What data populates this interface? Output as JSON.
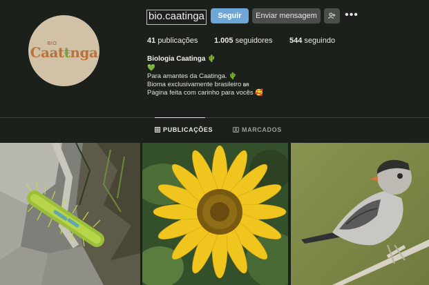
{
  "profile": {
    "username": "bio.caatinga",
    "avatar": {
      "logo_small": "BIO",
      "logo_main_left": "Caat",
      "logo_main_mid": "ŧ",
      "logo_main_right": "nga"
    }
  },
  "actions": {
    "follow_label": "Seguir",
    "message_label": "Enviar mensagem",
    "suggest_icon": "person-add-icon",
    "more_icon": "•••"
  },
  "stats": {
    "posts_count": "41",
    "posts_label": "publicações",
    "followers_count": "1.005",
    "followers_label": "seguidores",
    "following_count": "544",
    "following_label": "seguindo"
  },
  "bio": {
    "name": "Biologia Caatinga",
    "name_emoji": "🌵",
    "line_heart": "💚",
    "line1": "Para amantes da Caatinga.",
    "line1_emoji": "🌵",
    "line2": "Bioma exclusivamente brasileiro",
    "line2_flag": "BR",
    "line3": "Página feita com carinho para vocês",
    "line3_emoji": "🥰"
  },
  "tabs": [
    {
      "label": "PUBLICAÇÕES",
      "icon": "grid-icon",
      "active": true
    },
    {
      "label": "MARCADOS",
      "icon": "tag-icon",
      "active": false
    }
  ],
  "posts": [
    {
      "subject": "caterpillar-on-rock"
    },
    {
      "subject": "sunflower"
    },
    {
      "subject": "bird-on-branch"
    }
  ],
  "colors": {
    "accent": "#6ea6d6",
    "background": "#1c201b",
    "button": "#4a4f49"
  }
}
